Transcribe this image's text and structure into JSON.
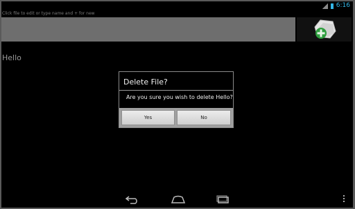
{
  "status_bar": {
    "time": "6:16",
    "accent_color": "#33b5e5"
  },
  "hint": "Click file to edit or type name and + for new",
  "add_button": {
    "icon": "add-file-icon"
  },
  "files": [
    {
      "name": "Hello"
    }
  ],
  "dialog": {
    "title": "Delete File?",
    "message": "Are you sure you wish to delete Hello?",
    "yes_label": "Yes",
    "no_label": "No"
  },
  "nav": {
    "back_icon": "back-icon",
    "home_icon": "home-icon",
    "recent_icon": "recent-apps-icon",
    "menu_icon": "overflow-menu-icon"
  }
}
